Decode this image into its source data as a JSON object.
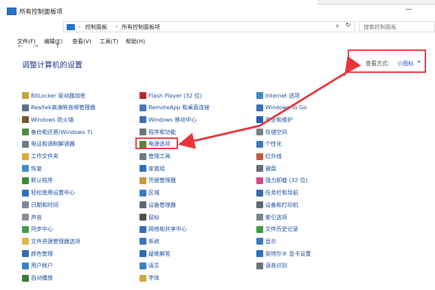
{
  "window": {
    "title": "所有控制面板项",
    "minimize_glyph": "—"
  },
  "address": {
    "crumbs": [
      "控制面板",
      "所有控制面板项"
    ],
    "search_placeholder": "搜索控制面板",
    "back_glyph": "←",
    "forward_glyph": "→",
    "up_glyph": "↑",
    "sep_glyph": "›",
    "dropdown_glyph": "∨",
    "refresh_glyph": "↻"
  },
  "menu": [
    "文件(F)",
    "编辑(E)",
    "查看(V)",
    "工具(T)",
    "帮助(H)"
  ],
  "page_title": "调整计算机的设置",
  "view": {
    "label": "查看方式:",
    "value": "小图标",
    "caret": "▾"
  },
  "columns": [
    [
      {
        "label": "BitLocker 驱动器加密",
        "icon": "bitlocker-icon",
        "color": "#c9a43a"
      },
      {
        "label": "Realtek高清晰音频管理器",
        "icon": "realtek-audio-icon",
        "color": "#5a6f8c"
      },
      {
        "label": "Windows 防火墙",
        "icon": "firewall-icon",
        "color": "#7a5530"
      },
      {
        "label": "备份和还原(Windows 7)",
        "icon": "backup-icon",
        "color": "#4f8d3a"
      },
      {
        "label": "电话和调制解调器",
        "icon": "phone-modem-icon",
        "color": "#6d7b8c"
      },
      {
        "label": "工作文件夹",
        "icon": "work-folders-icon",
        "color": "#d9a93a"
      },
      {
        "label": "恢复",
        "icon": "recovery-icon",
        "color": "#3b8fd0"
      },
      {
        "label": "默认程序",
        "icon": "default-programs-icon",
        "color": "#3f8a3c"
      },
      {
        "label": "轻松使用设置中心",
        "icon": "ease-of-access-icon",
        "color": "#2f6fc4"
      },
      {
        "label": "日期和时间",
        "icon": "date-time-icon",
        "color": "#7c8a9a"
      },
      {
        "label": "声音",
        "icon": "sound-icon",
        "color": "#8a8f96"
      },
      {
        "label": "同步中心",
        "icon": "sync-center-icon",
        "color": "#3fa046"
      },
      {
        "label": "文件资源管理器选项",
        "icon": "explorer-options-icon",
        "color": "#e0b74a"
      },
      {
        "label": "颜色管理",
        "icon": "color-management-icon",
        "color": "#3868b4"
      },
      {
        "label": "用户帐户",
        "icon": "user-accounts-icon",
        "color": "#3d7fc4"
      },
      {
        "label": "自动播放",
        "icon": "autoplay-icon",
        "color": "#3a7a3a"
      }
    ],
    [
      {
        "label": "Flash Player (32 位)",
        "icon": "flash-player-icon",
        "color": "#b8282c"
      },
      {
        "label": "RemoteApp 和桌面连接",
        "icon": "remoteapp-icon",
        "color": "#4a77b8"
      },
      {
        "label": "Windows 移动中心",
        "icon": "mobility-center-icon",
        "color": "#3f6fb0"
      },
      {
        "label": "程序和功能",
        "icon": "programs-features-icon",
        "color": "#6b7380"
      },
      {
        "label": "电源选项",
        "icon": "power-options-icon",
        "color": "#4c8a3c"
      },
      {
        "label": "管理工具",
        "icon": "admin-tools-icon",
        "color": "#6e7a88"
      },
      {
        "label": "家庭组",
        "icon": "homegroup-icon",
        "color": "#2f6fbf"
      },
      {
        "label": "凭据管理器",
        "icon": "credential-manager-icon",
        "color": "#c49a3a"
      },
      {
        "label": "区域",
        "icon": "region-icon",
        "color": "#3a7cc4"
      },
      {
        "label": "设备管理器",
        "icon": "device-manager-icon",
        "color": "#5d6772"
      },
      {
        "label": "鼠标",
        "icon": "mouse-icon",
        "color": "#4d4d4d"
      },
      {
        "label": "网络和共享中心",
        "icon": "network-sharing-icon",
        "color": "#3a6db4"
      },
      {
        "label": "系统",
        "icon": "system-icon",
        "color": "#3d74bc"
      },
      {
        "label": "疑难解答",
        "icon": "troubleshooting-icon",
        "color": "#2e69b5"
      },
      {
        "label": "语言",
        "icon": "language-icon",
        "color": "#3a7fc2"
      },
      {
        "label": "字体",
        "icon": "fonts-icon",
        "color": "#d1a640"
      }
    ],
    [
      {
        "label": "Internet 选项",
        "icon": "internet-options-icon",
        "color": "#3b88c9"
      },
      {
        "label": "Windows To Go",
        "icon": "windows-to-go-icon",
        "color": "#3c6fb8"
      },
      {
        "label": "安全和维护",
        "icon": "security-maintenance-icon",
        "color": "#2b5fb0"
      },
      {
        "label": "存储空间",
        "icon": "storage-spaces-icon",
        "color": "#7a7f87"
      },
      {
        "label": "个性化",
        "icon": "personalization-icon",
        "color": "#3c78c2"
      },
      {
        "label": "红外线",
        "icon": "infrared-icon",
        "color": "#c45a3a"
      },
      {
        "label": "键盘",
        "icon": "keyboard-icon",
        "color": "#6a6f75"
      },
      {
        "label": "强力卸载 (32 位)",
        "icon": "uninstall-icon",
        "color": "#d94a8c"
      },
      {
        "label": "任务栏和导航",
        "icon": "taskbar-navigation-icon",
        "color": "#3868b0"
      },
      {
        "label": "设备和打印机",
        "icon": "devices-printers-icon",
        "color": "#5f6873"
      },
      {
        "label": "索引选项",
        "icon": "indexing-options-icon",
        "color": "#7d8590"
      },
      {
        "label": "文件历史记录",
        "icon": "file-history-icon",
        "color": "#3c9a46"
      },
      {
        "label": "显示",
        "icon": "display-icon",
        "color": "#3a78c6"
      },
      {
        "label": "英特尔® 显卡设置",
        "icon": "intel-graphics-icon",
        "color": "#2b70c2"
      },
      {
        "label": "语音识别",
        "icon": "speech-recognition-icon",
        "color": "#6c7480"
      }
    ]
  ],
  "colors": {
    "link": "#1a4c9c",
    "title": "#1e3287",
    "highlight": "#e8343a",
    "view_value": "#1b57c4"
  }
}
